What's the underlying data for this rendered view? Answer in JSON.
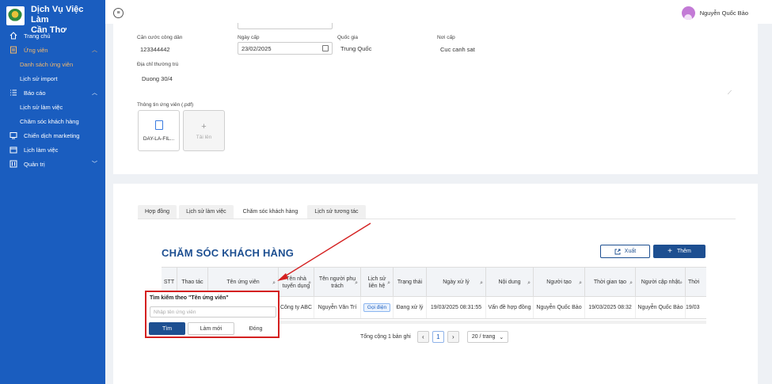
{
  "brand": {
    "line1": "Dịch Vụ Việc Làm",
    "line2": "Cần Thơ"
  },
  "sidebar": {
    "items": [
      {
        "label": "Trang chủ",
        "icon": "home-icon"
      },
      {
        "label": "Ứng viên",
        "icon": "candidate-icon"
      },
      {
        "label": "Danh sách ứng viên"
      },
      {
        "label": "Lịch sử import"
      },
      {
        "label": "Báo cáo",
        "icon": "list-icon"
      },
      {
        "label": "Lịch sử làm việc"
      },
      {
        "label": "Chăm sóc khách hàng"
      },
      {
        "label": "Chiến dịch marketing",
        "icon": "campaign-icon"
      },
      {
        "label": "Lịch làm việc",
        "icon": "calendar-icon"
      },
      {
        "label": "Quản trị",
        "icon": "admin-icon"
      }
    ]
  },
  "topbar": {
    "user_name": "Nguyễn Quốc Bảo"
  },
  "form": {
    "id_label": "Căn cước công dân",
    "id_value": "123344442",
    "issue_date_label": "Ngày cấp",
    "issue_date_value": "23/02/2025",
    "country_label": "Quốc gia",
    "country_value": "Trung Quốc",
    "issue_place_label": "Nơi cấp",
    "issue_place_value": "Cuc canh sat",
    "address_label": "Địa chỉ thường trú",
    "address_value": "Duong 30/4",
    "attach_label": "Thông tin ứng viên (.pdf)",
    "file_name": "DAY-LA-FIL...",
    "upload_label": "Tải lên"
  },
  "tabs": [
    "Hợp đồng",
    "Lịch sử làm việc",
    "Chăm sóc khách hàng",
    "Lịch sử tương tác"
  ],
  "section": {
    "title": "CHĂM SÓC KHÁCH HÀNG",
    "export_label": "Xuất",
    "add_label": "Thêm"
  },
  "table": {
    "headers": [
      "STT",
      "Thao tác",
      "Tên ứng viên",
      "Tên nhà tuyển dụng",
      "Tên người phụ trách",
      "Lịch sử liên hệ",
      "Trạng thái",
      "Ngày xử lý",
      "Nội dung",
      "Người tạo",
      "Thời gian tạo",
      "Người cập nhật",
      "Thời"
    ],
    "row": [
      "",
      "",
      "",
      "Công ty ABC",
      "Nguyễn Văn Trí",
      "Gọi điện",
      "Đang xử lý",
      "19/03/2025 08:31:55",
      "Vấn đề hợp đồng",
      "Nguyễn Quốc Bảo",
      "19/03/2025 08:32",
      "Nguyễn Quốc Bảo",
      "19/03"
    ]
  },
  "pagination": {
    "total_text": "Tổng cộng 1 bản ghi",
    "current_page": "1",
    "page_size": "20 / trang"
  },
  "filter_popup": {
    "title": "Tìm kiếm theo \"Tên ứng viên\"",
    "placeholder": "Nhập tên ứng viên",
    "search_label": "Tìm",
    "reset_label": "Làm mới",
    "close_label": "Đóng"
  },
  "colors": {
    "sidebar": "#1a5dbf",
    "accent": "#1d4f91",
    "highlight": "#f6b96a",
    "annotation": "#d42020"
  }
}
